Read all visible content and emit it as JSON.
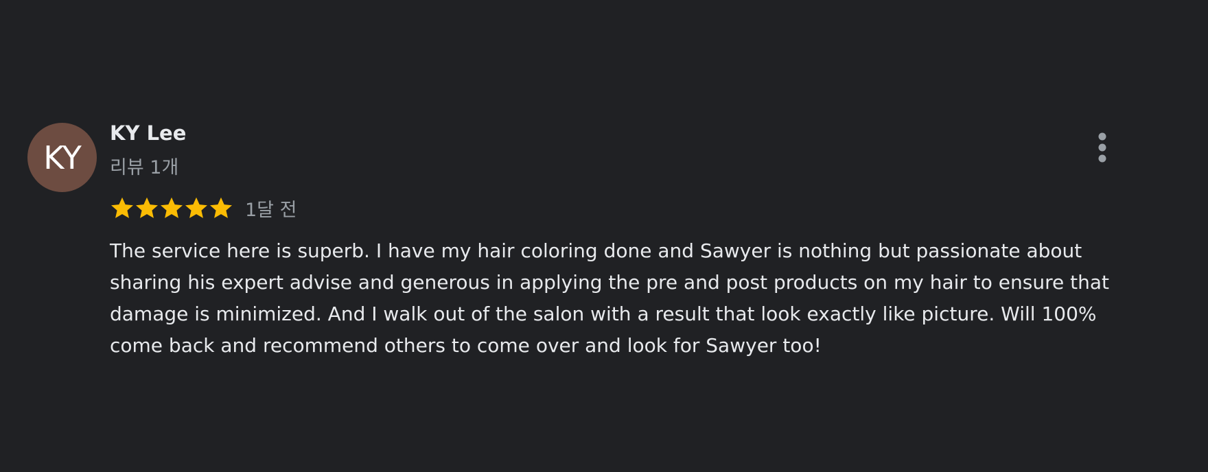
{
  "review": {
    "avatar_initials": "KY",
    "avatar_color": "#6d4c41",
    "author_name": "KY Lee",
    "review_count": "리뷰 1개",
    "rating": 5,
    "max_rating": 5,
    "star_color": "#fbbc04",
    "time_ago": "1달 전",
    "text": "The service here is superb. I have my hair coloring done and Sawyer is nothing but passionate about sharing his expert advise and generous in applying the pre and post products on my hair to ensure that damage is minimized. And I walk out of the salon with a result that look exactly like picture. Will 100% come back and recommend others to come over and look for Sawyer too!",
    "more_icon": "more-vert-icon"
  },
  "theme": {
    "background": "#202124",
    "primary_text": "#e8eaed",
    "secondary_text": "#9aa0a6"
  }
}
